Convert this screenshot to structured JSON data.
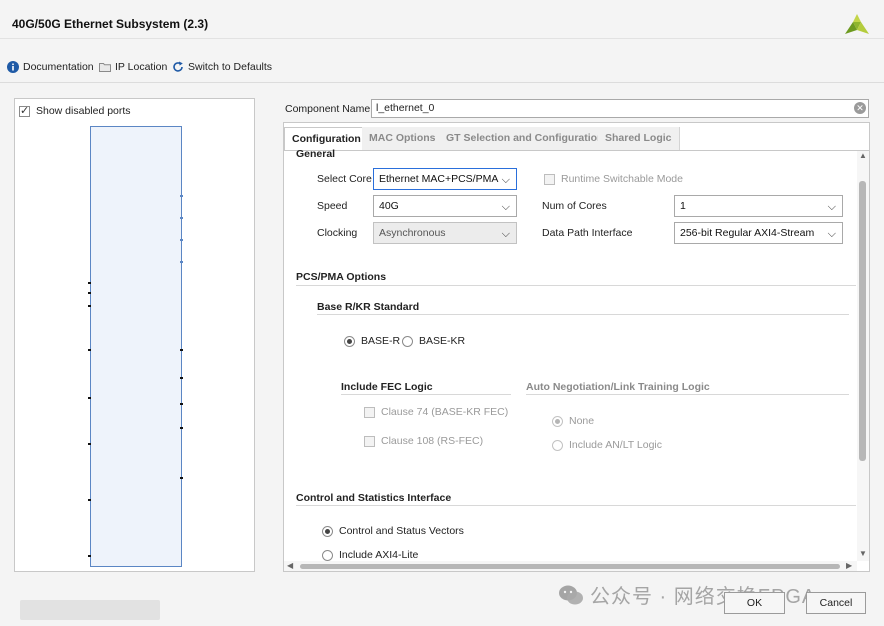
{
  "window": {
    "title": "40G/50G Ethernet Subsystem (2.3)"
  },
  "toolbar": {
    "documentation": "Documentation",
    "ip_location": "IP Location",
    "switch_defaults": "Switch to Defaults"
  },
  "left_panel": {
    "show_disabled_ports": "Show disabled ports"
  },
  "component": {
    "label": "Component Name",
    "value": "l_ethernet_0"
  },
  "tabs": [
    {
      "label": "Configuration",
      "active": true
    },
    {
      "label": "MAC Options",
      "active": false
    },
    {
      "label": "GT Selection and Configuration",
      "active": false
    },
    {
      "label": "Shared Logic",
      "active": false
    }
  ],
  "general": {
    "title": "General",
    "select_core": {
      "label": "Select Core",
      "value": "Ethernet MAC+PCS/PMA"
    },
    "runtime_switchable": "Runtime Switchable Mode",
    "speed": {
      "label": "Speed",
      "value": "40G"
    },
    "num_cores": {
      "label": "Num of Cores",
      "value": "1"
    },
    "clocking": {
      "label": "Clocking",
      "value": "Asynchronous"
    },
    "data_path": {
      "label": "Data Path Interface",
      "value": "256-bit Regular AXI4-Stream"
    }
  },
  "pcs_pma": {
    "title": "PCS/PMA Options",
    "base_standard": {
      "title": "Base R/KR Standard",
      "base_r": "BASE-R",
      "base_kr": "BASE-KR"
    },
    "fec": {
      "title": "Include FEC Logic",
      "clause74": "Clause 74 (BASE-KR FEC)",
      "clause108": "Clause 108 (RS-FEC)"
    },
    "autoneg": {
      "title": "Auto Negotiation/Link Training Logic",
      "none": "None",
      "include": "Include AN/LT Logic"
    }
  },
  "control": {
    "title": "Control and Statistics Interface",
    "vectors": "Control and Status Vectors",
    "axi4lite": "Include AXI4-Lite"
  },
  "buttons": {
    "ok": "OK",
    "cancel": "Cancel"
  },
  "watermark": {
    "text": "公众号 · 网络交换FPGA"
  },
  "colors": {
    "accent": "#2a6fdb",
    "info": "#1f5aa6",
    "logo_green": "#8fb52d"
  },
  "icons": [
    "info-icon",
    "folder-icon",
    "refresh-icon",
    "clear-icon",
    "chevron-down-icon",
    "wechat-icon",
    "vivado-logo-icon"
  ]
}
